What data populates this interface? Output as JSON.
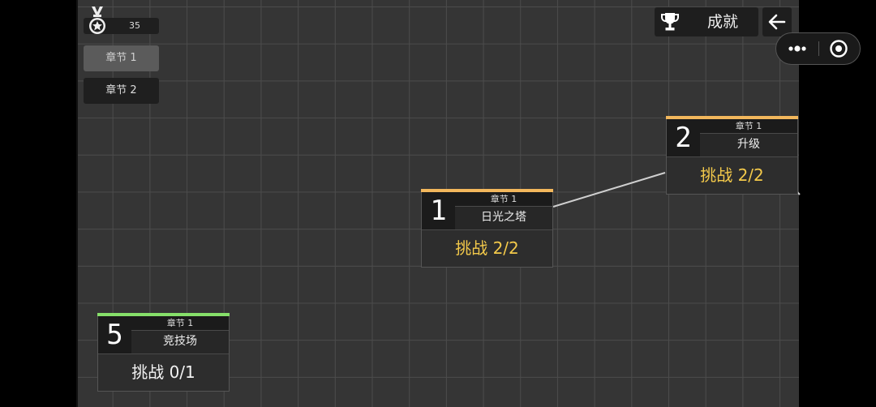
{
  "hud": {
    "medal_count": "35",
    "medal_icon": "medal-icon",
    "chapters": [
      {
        "label": "章节 1",
        "active": true
      },
      {
        "label": "章节 2",
        "active": false
      }
    ],
    "achievements_label": "成就",
    "achievements_icon": "trophy-icon",
    "back_icon": "arrow-left-icon"
  },
  "capsule": {
    "more_icon": "more-dots-icon",
    "close_icon": "target-circle-icon"
  },
  "nodes": [
    {
      "number": "1",
      "chapter": "章节 1",
      "name": "日光之塔",
      "challenge": "挑战 2/2",
      "accent_color": "#f2b75c",
      "challenge_color": "#f3c94a"
    },
    {
      "number": "2",
      "chapter": "章节 1",
      "name": "升级",
      "challenge": "挑战 2/2",
      "accent_color": "#f2b75c",
      "challenge_color": "#f3c94a"
    },
    {
      "number": "5",
      "chapter": "章节 1",
      "name": "竞技场",
      "challenge": "挑战 0/1",
      "accent_color": "#86e06a",
      "challenge_color": "#f2f2f2"
    }
  ],
  "colors": {
    "background": "#353535",
    "grid": "#4c4c4c",
    "connector": "#cfcfcf"
  }
}
